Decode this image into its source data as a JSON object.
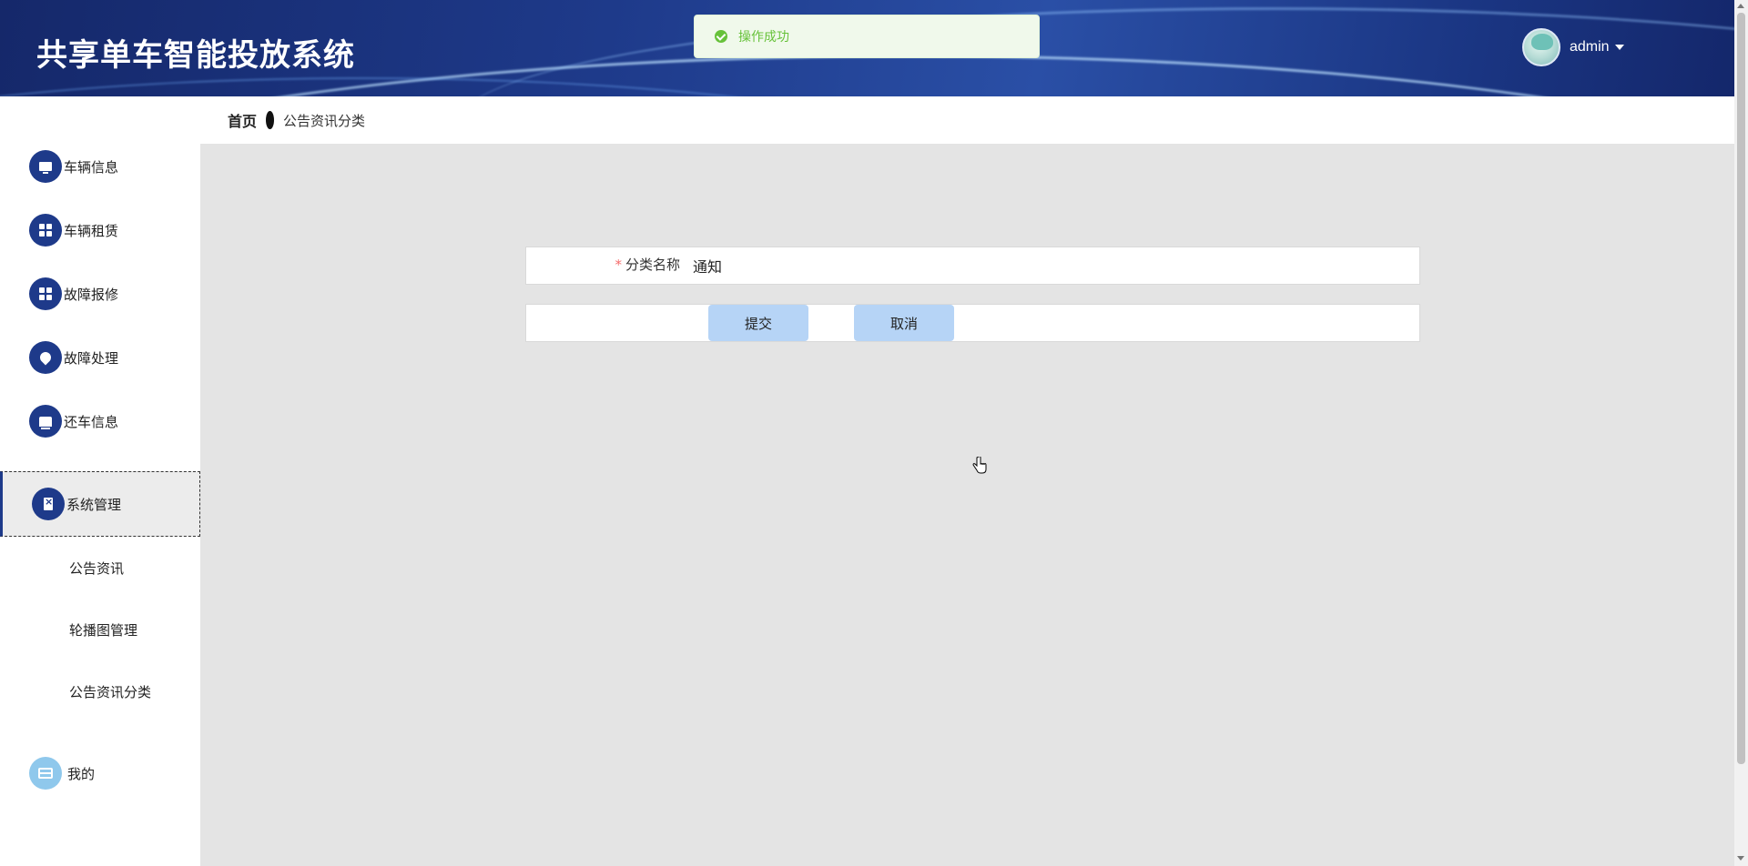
{
  "header": {
    "app_title": "共享单车智能投放系统",
    "username": "admin"
  },
  "toast": {
    "message": "操作成功",
    "type": "success"
  },
  "sidebar": {
    "items": [
      {
        "label": "车辆信息",
        "icon": "monitor-icon"
      },
      {
        "label": "车辆租赁",
        "icon": "grid-icon"
      },
      {
        "label": "故障报修",
        "icon": "grid-icon"
      },
      {
        "label": "故障处理",
        "icon": "location-pin-icon"
      },
      {
        "label": "还车信息",
        "icon": "cart-icon"
      },
      {
        "label": "系统管理",
        "icon": "clipboard-icon",
        "active": true
      },
      {
        "label": "我的",
        "icon": "frame-icon"
      }
    ],
    "sub_items": [
      {
        "label": "公告资讯"
      },
      {
        "label": "轮播图管理"
      },
      {
        "label": "公告资讯分类"
      }
    ]
  },
  "breadcrumb": {
    "home": "首页",
    "current": "公告资讯分类"
  },
  "form": {
    "field_label": "分类名称",
    "required_mark": "*",
    "field_value": "通知",
    "submit_label": "提交",
    "cancel_label": "取消"
  },
  "colors": {
    "header_bg": "#1e3a8a",
    "accent": "#1e3a8a",
    "success": "#67c23a",
    "button_bg": "#b6d4f6",
    "main_bg": "#e4e4e4"
  }
}
